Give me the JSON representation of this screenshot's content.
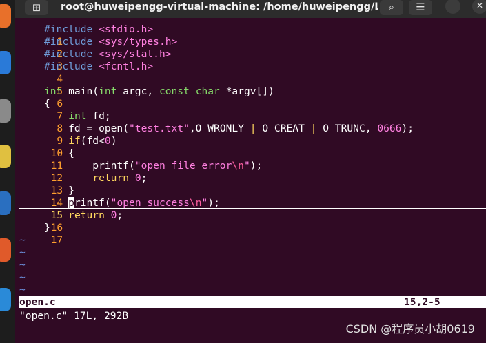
{
  "window": {
    "title": "root@huweipengg-virtual-machine: /home/huweipengg/Lin...",
    "newtab_icon": "⊞",
    "search_icon": "⌕",
    "menu_icon": "☰",
    "minimize_icon": "—",
    "close_icon": "✕"
  },
  "editor": {
    "lines": [
      {
        "num": "1",
        "text": "#include <stdio.h>"
      },
      {
        "num": "2",
        "text": "#include <sys/types.h>"
      },
      {
        "num": "3",
        "text": "#include <sys/stat.h>"
      },
      {
        "num": "4",
        "text": "#include <fcntl.h>"
      },
      {
        "num": "5",
        "text": ""
      },
      {
        "num": "6",
        "text": "int main(int argc, const char *argv[])"
      },
      {
        "num": "7",
        "text": "{"
      },
      {
        "num": "8",
        "text": "    int fd;"
      },
      {
        "num": "9",
        "text": "    fd = open(\"test.txt\",O_WRONLY | O_CREAT | O_TRUNC, 0666);"
      },
      {
        "num": "10",
        "text": "    if(fd<0)"
      },
      {
        "num": "11",
        "text": "    {"
      },
      {
        "num": "12",
        "text": "        printf(\"open file error\\n\");"
      },
      {
        "num": "13",
        "text": "        return 0;"
      },
      {
        "num": "14",
        "text": "    }"
      },
      {
        "num": "15",
        "text": "    printf(\"open success\\n\");"
      },
      {
        "num": "16",
        "text": "    return 0;"
      },
      {
        "num": "17",
        "text": "}"
      }
    ],
    "tilde": "~"
  },
  "status": {
    "filename": "open.c",
    "position": "15,2-5",
    "message": "\"open.c\" 17L, 292B"
  },
  "watermark": "CSDN @程序员小胡0619",
  "colors": {
    "background": "#300a24",
    "line_number": "#ff9f2e",
    "preprocessor": "#6f9cd9",
    "string": "#ff80e0",
    "type": "#86d96a",
    "keyword": "#ffd75f",
    "tilde": "#6a8cd6"
  }
}
